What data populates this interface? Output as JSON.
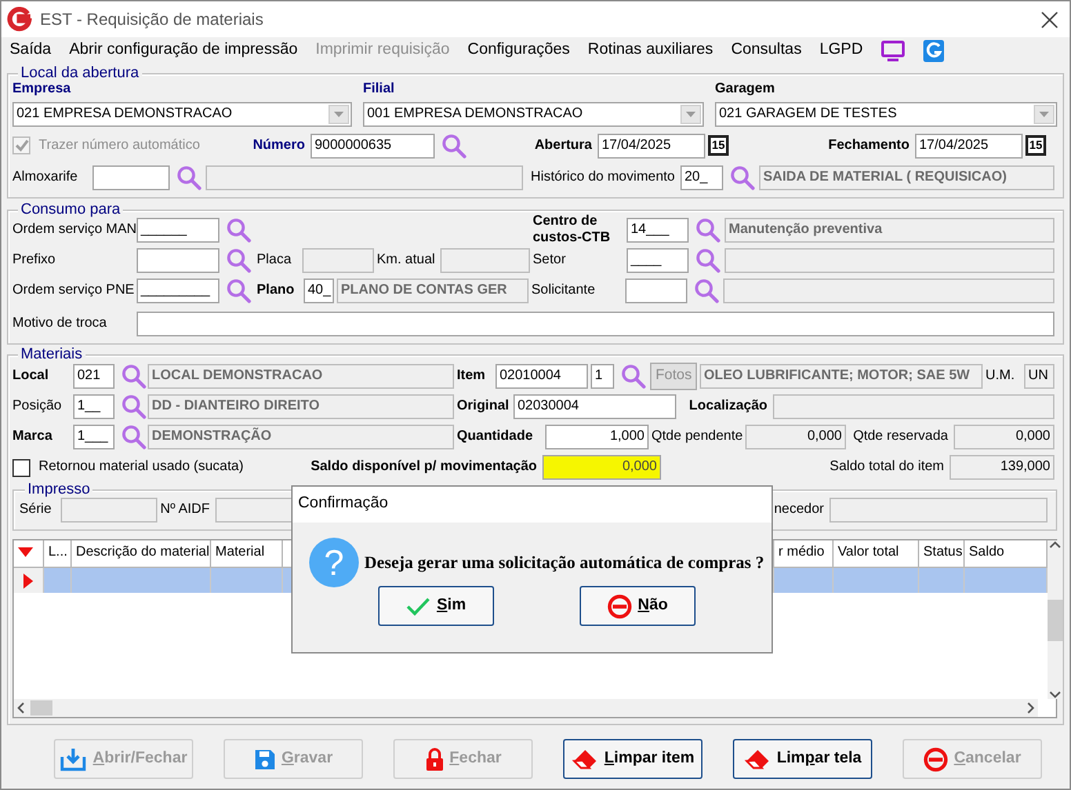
{
  "window": {
    "title": "EST - Requisição de materiais"
  },
  "menu": [
    {
      "label": "Saída",
      "disabled": false
    },
    {
      "label": "Abrir configuração de impressão",
      "disabled": false
    },
    {
      "label": "Imprimir requisição",
      "disabled": true
    },
    {
      "label": "Configurações",
      "disabled": false
    },
    {
      "label": "Rotinas auxiliares",
      "disabled": false
    },
    {
      "label": "Consultas",
      "disabled": false
    },
    {
      "label": "LGPD",
      "disabled": false
    }
  ],
  "local_abertura": {
    "legend": "Local da abertura",
    "empresa": {
      "label": "Empresa",
      "value": "021 EMPRESA DEMONSTRACAO"
    },
    "filial": {
      "label": "Filial",
      "value": "001 EMPRESA DEMONSTRACAO"
    },
    "garagem": {
      "label": "Garagem",
      "value": "021 GARAGEM DE TESTES"
    },
    "trazer_numero": {
      "label": "Trazer número automático",
      "checked": true,
      "disabled": true
    },
    "numero": {
      "label": "Número",
      "value": "9000000635"
    },
    "abertura": {
      "label": "Abertura",
      "value": "17/04/2025",
      "calendar_day": "15"
    },
    "fechamento": {
      "label": "Fechamento",
      "value": "17/04/2025",
      "calendar_day": "15"
    },
    "almoxarife": {
      "label": "Almoxarife"
    },
    "historico": {
      "label": "Histórico do movimento",
      "code": "20_",
      "description": "SAIDA DE MATERIAL ( REQUISICAO)"
    }
  },
  "consumo_para": {
    "legend": "Consumo para",
    "ordem_servico_man": {
      "label": "Ordem serviço MAN",
      "value": "______"
    },
    "prefixo": {
      "label": "Prefixo"
    },
    "placa": {
      "label": "Placa"
    },
    "km_atual": {
      "label": "Km. atual"
    },
    "ordem_servico_pne": {
      "label": "Ordem serviço PNE",
      "value": "_________"
    },
    "plano": {
      "label": "Plano",
      "code": "40_",
      "description": "PLANO DE CONTAS GER"
    },
    "centro_custos": {
      "label": "Centro de custos-CTB",
      "code": "14___",
      "description": "Manutenção preventiva"
    },
    "setor": {
      "label": "Setor",
      "code": "____"
    },
    "solicitante": {
      "label": "Solicitante"
    },
    "motivo_troca": {
      "label": "Motivo de troca"
    }
  },
  "materiais": {
    "legend": "Materiais",
    "local": {
      "label": "Local",
      "code": "021",
      "description": "LOCAL DEMONSTRACAO"
    },
    "item": {
      "label": "Item",
      "code": "02010004",
      "sequence": "1",
      "photos_button": {
        "label": "Fotos",
        "disabled": true
      },
      "description": "OLEO LUBRIFICANTE; MOTOR; SAE 5W"
    },
    "unidade": {
      "label": "U.M.",
      "value": "UN"
    },
    "posicao": {
      "label": "Posição",
      "code": "1__",
      "description": "DD - DIANTEIRO DIREITO"
    },
    "original": {
      "label": "Original",
      "value": "02030004"
    },
    "localizacao": {
      "label": "Localização"
    },
    "marca": {
      "label": "Marca",
      "code": "1___",
      "description": "DEMONSTRAÇÃO"
    },
    "quantidade": {
      "label": "Quantidade",
      "value": "1,000"
    },
    "qtde_pendente": {
      "label": "Qtde pendente",
      "value": "0,000"
    },
    "qtde_reservada": {
      "label": "Qtde reservada",
      "value": "0,000"
    },
    "retornou": {
      "label": "Retornou material usado (sucata)",
      "checked": false
    },
    "saldo_disponivel": {
      "label": "Saldo disponível p/ movimentação",
      "value": "0,000",
      "highlighted": true
    },
    "saldo_total": {
      "label": "Saldo total do item",
      "value": "139,000"
    },
    "impresso": {
      "legend": "Impresso",
      "serie_label": "Série",
      "aidf_label": "Nº AIDF"
    },
    "nota_fiscal": {
      "fornecedor_label": "necedor"
    },
    "grid": {
      "columns": [
        "L...",
        "Descrição do material",
        "Material",
        "r médio",
        "Valor total",
        "Status",
        "Saldo"
      ],
      "rows": [
        {
          "selected": true
        }
      ]
    }
  },
  "dialog": {
    "title": "Confirmação",
    "icon_glyph": "?",
    "message": "Deseja gerar uma solicitação automática de compras ?",
    "buttons": [
      {
        "label": "Sim"
      },
      {
        "label": "Não"
      }
    ]
  },
  "buttons": [
    {
      "label": "Abrir/Fechar",
      "disabled": true
    },
    {
      "label": "Gravar",
      "disabled": true
    },
    {
      "label": "Fechar",
      "disabled": true
    },
    {
      "label": "Limpar item",
      "disabled": false
    },
    {
      "label": "Limpar tela",
      "disabled": false
    },
    {
      "label": "Cancelar",
      "disabled": true
    }
  ]
}
